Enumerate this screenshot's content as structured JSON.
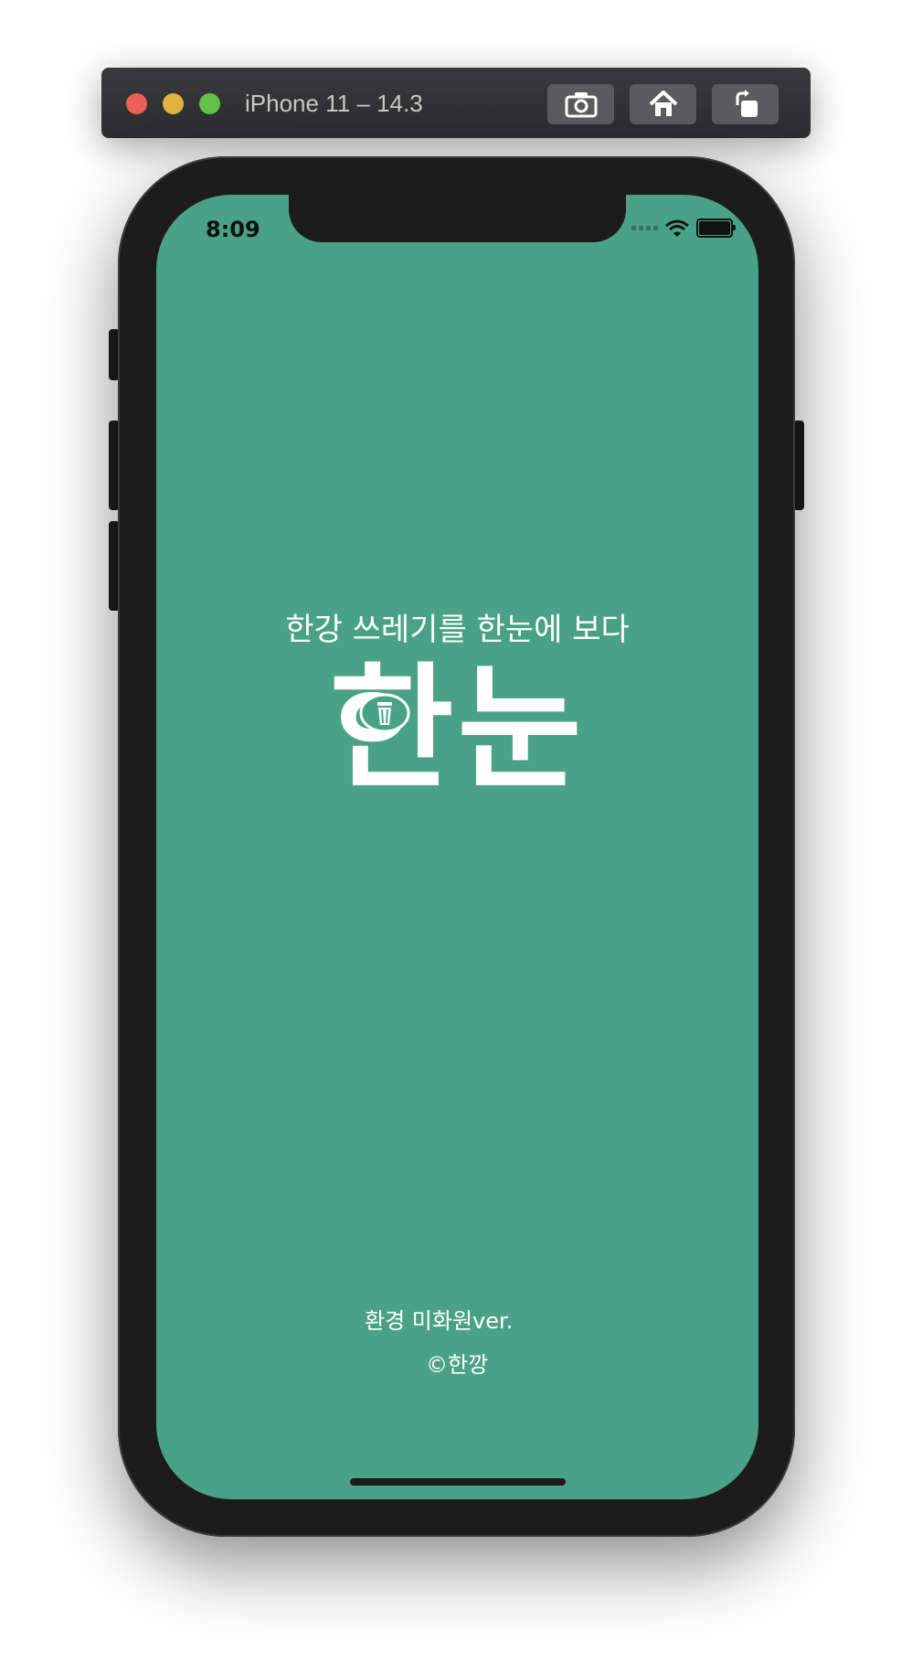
{
  "simulator": {
    "title": "iPhone 11 – 14.3",
    "buttons": {
      "screenshot_icon": "camera-icon",
      "home_icon": "home-icon",
      "rotate_icon": "rotate-icon"
    }
  },
  "status_bar": {
    "time": "8:09"
  },
  "splash": {
    "tagline": "한강 쓰레기를 한눈에 보다",
    "logo_text": "한눈",
    "footer_version": "환경 미화원ver.",
    "footer_copyright": "©한깡",
    "background_color": "#4aa286"
  }
}
